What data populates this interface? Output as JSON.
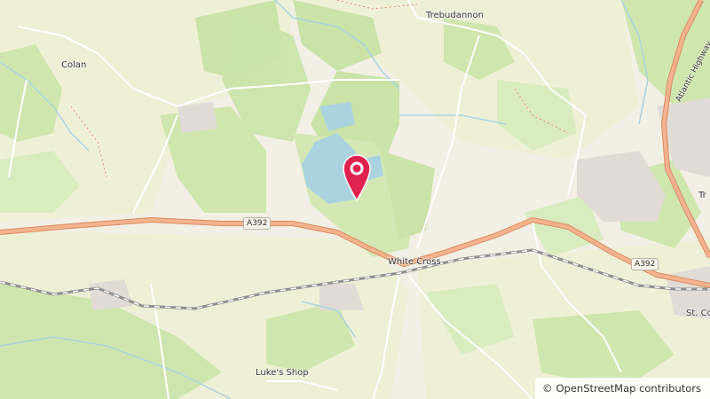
{
  "map": {
    "places": {
      "trebudannon": "Trebudannon",
      "colan": "Colan",
      "white_cross": "White Cross",
      "lukes_shop": "Luke's Shop",
      "st_co": "St. Co",
      "tr": "Tr"
    },
    "roads": {
      "a392_west": "A392",
      "a392_east": "A392",
      "atlantic_highway": "Atlantic Highway"
    },
    "attribution": {
      "symbol": "©",
      "text": "OpenStreetMap contributors"
    },
    "marker": {
      "icon": "map-pin-icon",
      "color": "#e0234e"
    },
    "colors": {
      "land": "#f2efe4",
      "grass": "#dcebc0",
      "wood": "#c9e3a8",
      "water": "#aad3df",
      "major_road": "#eaa07a",
      "railway": "#8f8f8f"
    }
  }
}
